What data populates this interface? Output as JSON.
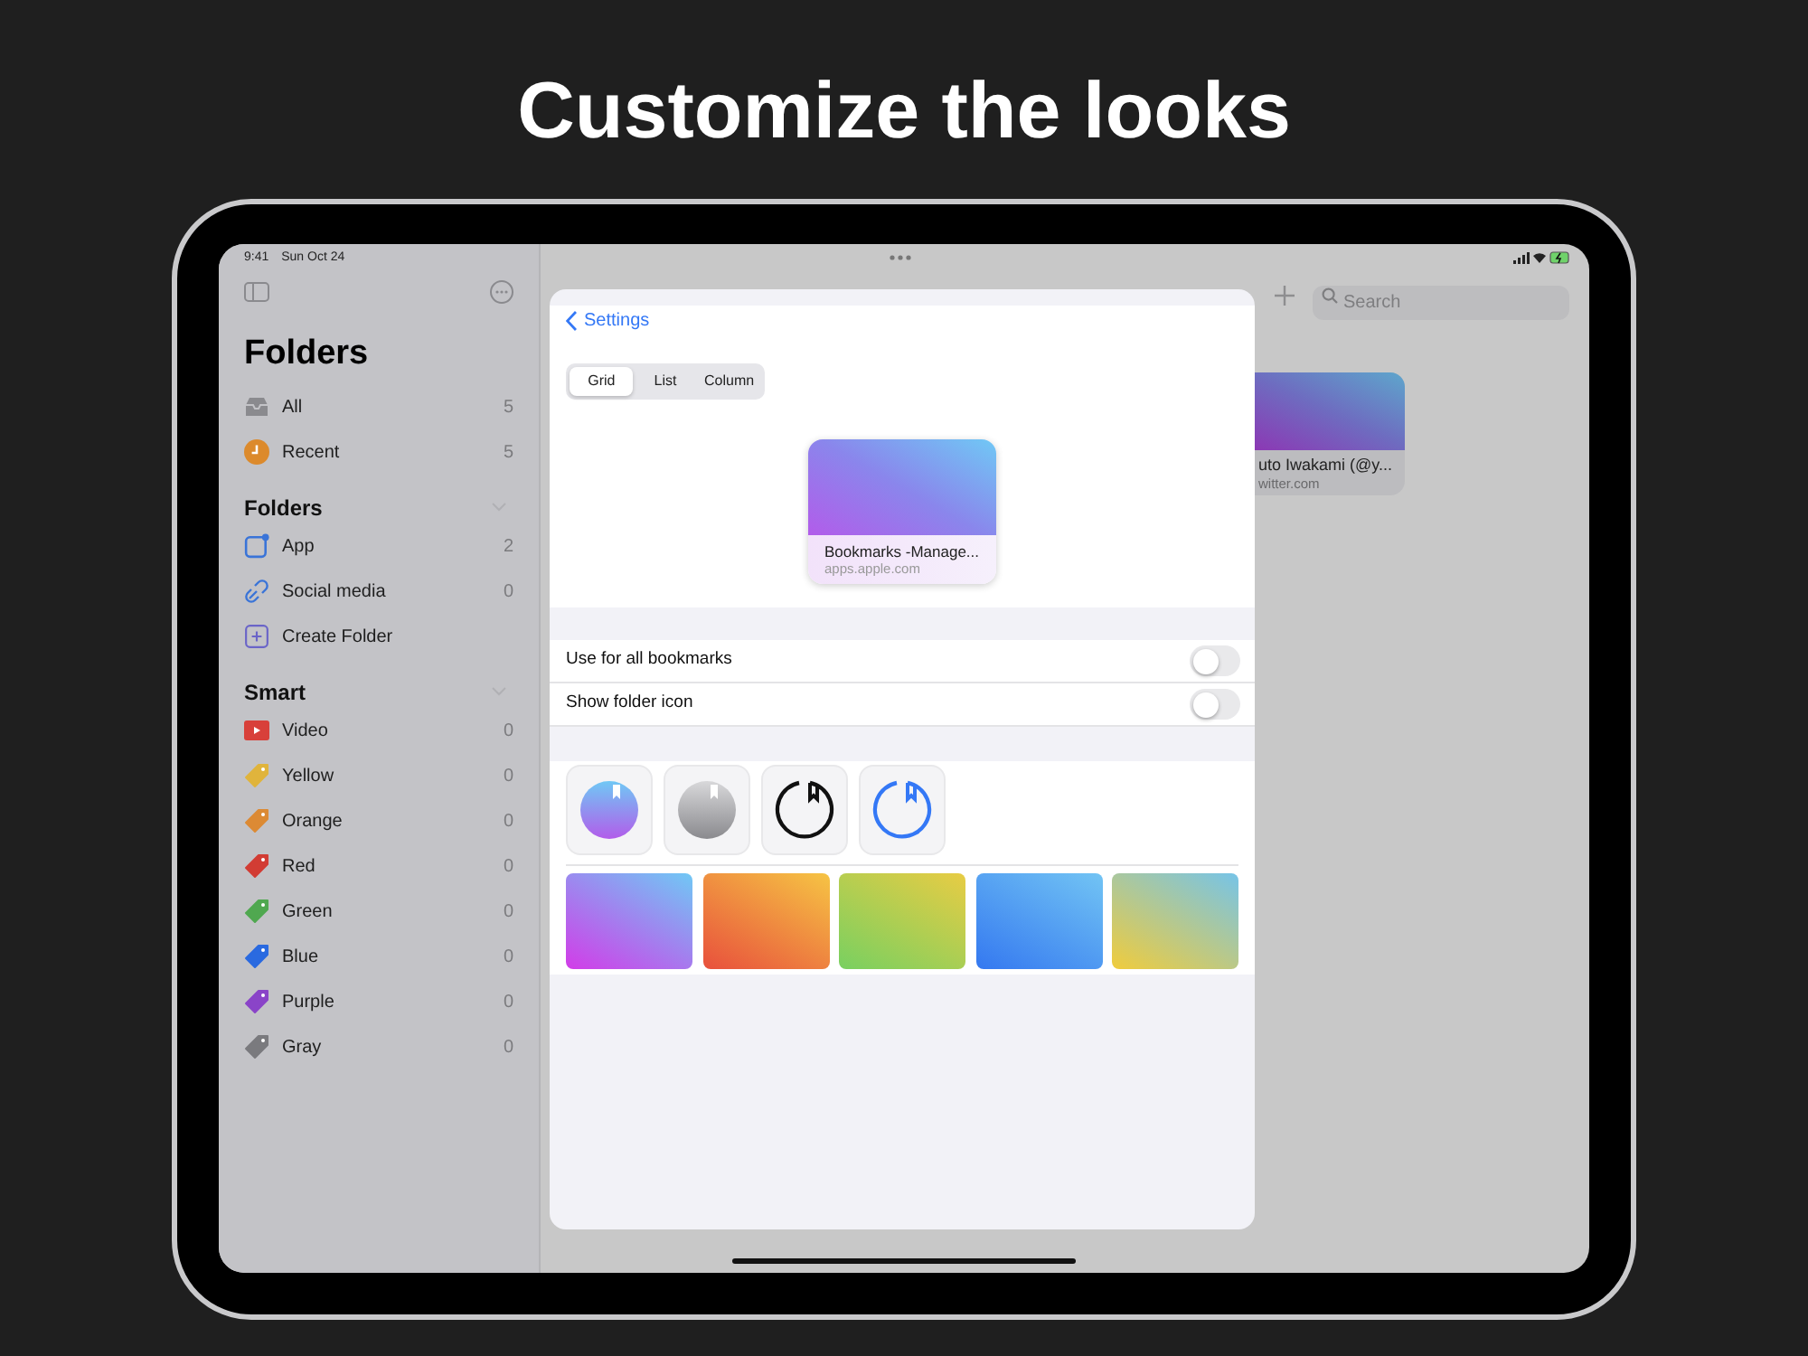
{
  "headline": "Customize the looks",
  "status_bar": {
    "time": "9:41",
    "date": "Sun Oct 24"
  },
  "sidebar": {
    "title": "Folders",
    "top_items": [
      {
        "kind": "all",
        "label": "All",
        "count": "5"
      },
      {
        "kind": "recent",
        "label": "Recent",
        "count": "5"
      }
    ],
    "sections": [
      {
        "title": "Folders",
        "items": [
          {
            "kind": "folder",
            "label": "App",
            "count": "2"
          },
          {
            "kind": "link",
            "label": "Social media",
            "count": "0"
          },
          {
            "kind": "create",
            "label": "Create Folder"
          }
        ]
      },
      {
        "title": "Smart",
        "items": [
          {
            "kind": "video",
            "label": "Video",
            "count": "0",
            "color": "#d8403a"
          },
          {
            "kind": "tag",
            "label": "Yellow",
            "count": "0",
            "color": "#e0b43c"
          },
          {
            "kind": "tag",
            "label": "Orange",
            "count": "0",
            "color": "#dc8a34"
          },
          {
            "kind": "tag",
            "label": "Red",
            "count": "0",
            "color": "#d23c34"
          },
          {
            "kind": "tag",
            "label": "Green",
            "count": "0",
            "color": "#50a850"
          },
          {
            "kind": "tag",
            "label": "Blue",
            "count": "0",
            "color": "#2a6ae0"
          },
          {
            "kind": "tag",
            "label": "Purple",
            "count": "0",
            "color": "#8a44c8"
          },
          {
            "kind": "tag",
            "label": "Gray",
            "count": "0",
            "color": "#7a7a7e"
          }
        ]
      }
    ]
  },
  "toolbar": {
    "search": {
      "placeholder": "Search"
    }
  },
  "background_card": {
    "title": "uto Iwakami (@y...",
    "url": "witter.com"
  },
  "settings_sheet": {
    "back": "Settings",
    "segments": [
      {
        "label": "Grid",
        "selected": true
      },
      {
        "label": "List",
        "selected": false
      },
      {
        "label": "Column",
        "selected": false
      }
    ],
    "preview": {
      "title": "Bookmarks -Manage...",
      "url": "apps.apple.com"
    },
    "toggles": [
      {
        "label": "Use for all bookmarks",
        "on": false
      },
      {
        "label": "Show folder icon",
        "on": false
      }
    ],
    "icon_styles": [
      {
        "kind": "gradient"
      },
      {
        "kind": "gray"
      },
      {
        "kind": "outline-black"
      },
      {
        "kind": "outline-blue"
      }
    ],
    "swatches": [
      {
        "kind": "purple"
      },
      {
        "kind": "orange"
      },
      {
        "kind": "lime"
      },
      {
        "kind": "blue"
      },
      {
        "kind": "teal"
      }
    ]
  }
}
